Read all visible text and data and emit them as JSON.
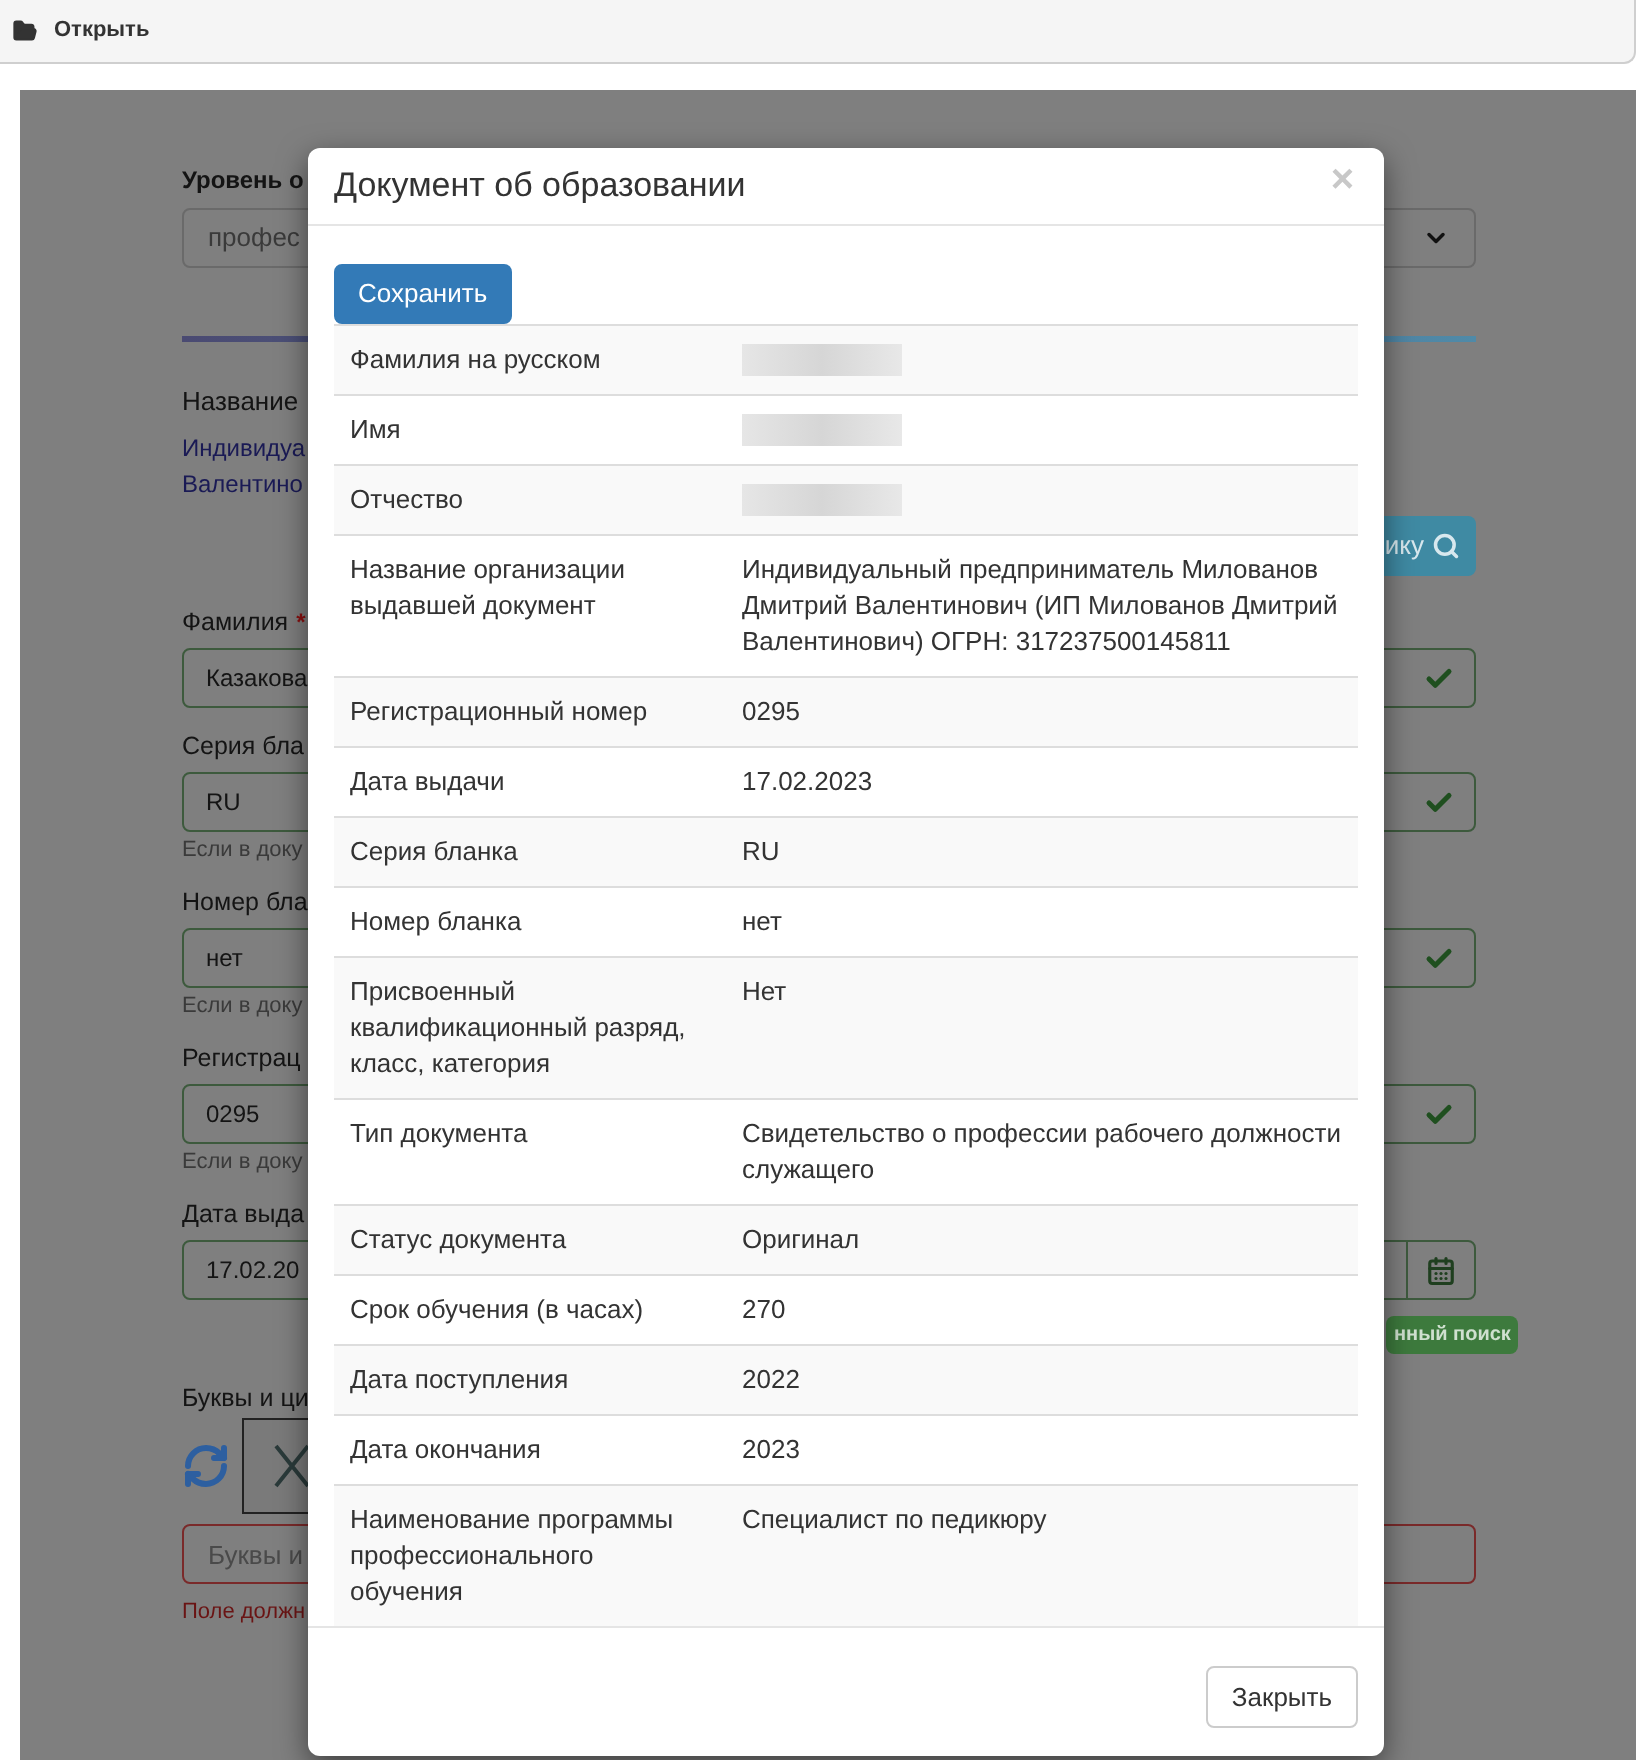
{
  "toolbar": {
    "open_button": "Открыть"
  },
  "background_form": {
    "level_label": "Уровень о",
    "level_select": "профес",
    "org_label": "Название",
    "org_lines": [
      "Индивидуа",
      "Валентино"
    ],
    "search_button": "ику",
    "fields": [
      {
        "kind": "text",
        "label": "Фамилия",
        "required_mark": "*",
        "value": "Казакова"
      },
      {
        "kind": "text",
        "label": "Серия бла",
        "value": "RU",
        "hint": "Если в доку"
      },
      {
        "kind": "text",
        "label": "Номер бла",
        "value": "нет",
        "hint": "Если в доку"
      },
      {
        "kind": "text",
        "label": "Регистрац",
        "value": "0295",
        "hint": "Если в доку"
      },
      {
        "kind": "date",
        "label": "Дата выда",
        "value": "17.02.20"
      }
    ],
    "badge": "нный поиск",
    "captcha": {
      "label": "Буквы и ци",
      "placeholder": "Буквы и",
      "error": "Поле должн"
    }
  },
  "modal": {
    "title": "Документ об образовании",
    "close": "×",
    "save_button": "Сохранить",
    "rows": [
      {
        "label": "Фамилия на русском",
        "kind": "redacted"
      },
      {
        "label": "Имя",
        "kind": "redacted"
      },
      {
        "label": "Отчество",
        "kind": "redacted"
      },
      {
        "label": "Название организации выдавшей документ",
        "kind": "text",
        "value": "Индивидуальный предприниматель Милованов Дмитрий Валентинович (ИП Милованов Дмитрий Валентинович) ОГРН: 317237500145811"
      },
      {
        "label": "Регистрационный номер",
        "kind": "text",
        "value": "0295"
      },
      {
        "label": "Дата выдачи",
        "kind": "text",
        "value": "17.02.2023"
      },
      {
        "label": "Серия бланка",
        "kind": "text",
        "value": "RU"
      },
      {
        "label": "Номер бланка",
        "kind": "text",
        "value": "нет"
      },
      {
        "label": "Присвоенный квалификационный разряд, класс, категория",
        "kind": "text",
        "value": "Нет"
      },
      {
        "label": "Тип документа",
        "kind": "text",
        "value": "Свидетельство о профессии рабочего должности служащего"
      },
      {
        "label": "Статус документа",
        "kind": "text",
        "value": "Оригинал"
      },
      {
        "label": "Срок обучения (в часах)",
        "kind": "text",
        "value": "270"
      },
      {
        "label": "Дата поступления",
        "kind": "text",
        "value": "2022"
      },
      {
        "label": "Дата окончания",
        "kind": "text",
        "value": "2023"
      },
      {
        "label": "Наименование программы профессионального обучения",
        "kind": "text",
        "value": "Специалист по педикюру"
      }
    ],
    "close_button": "Закрыть"
  }
}
